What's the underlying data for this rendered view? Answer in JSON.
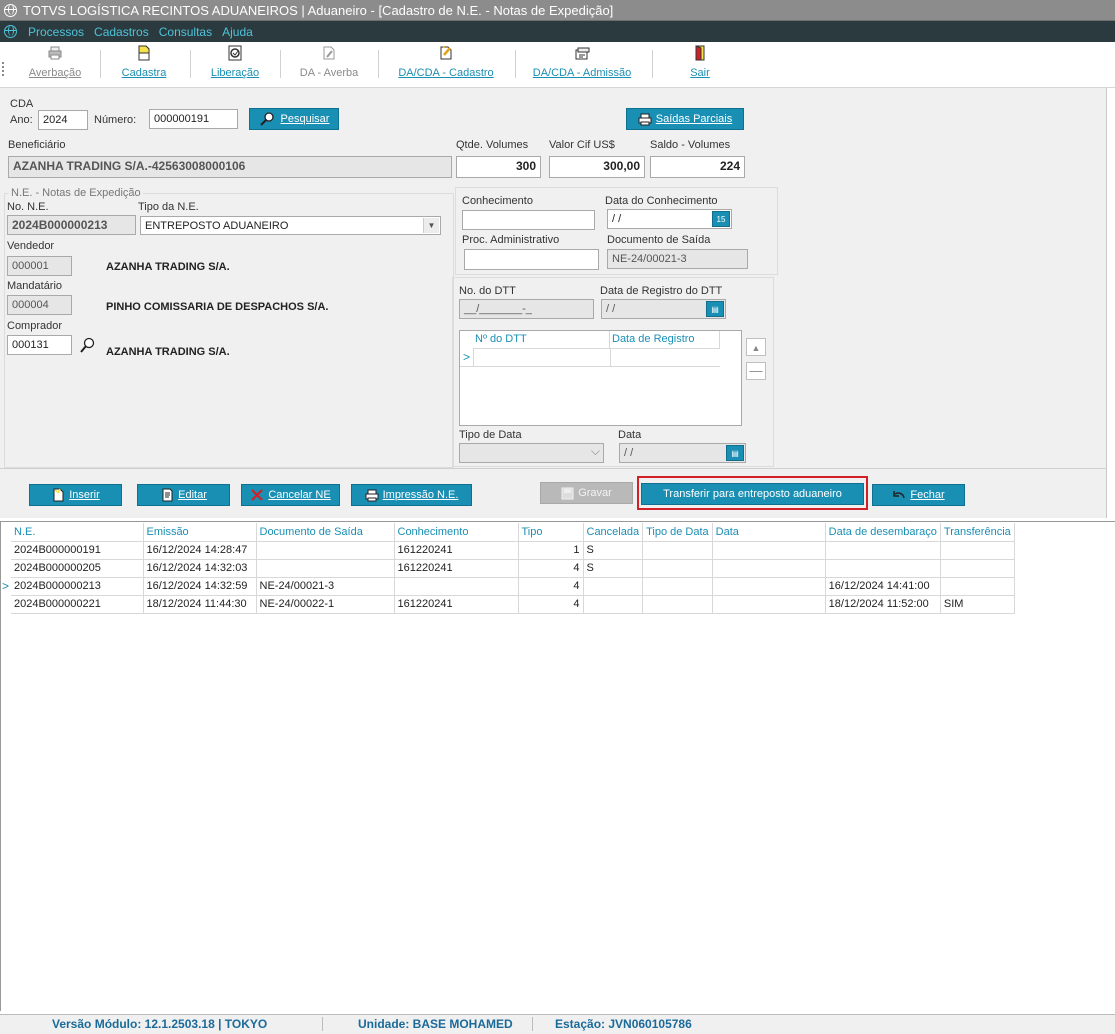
{
  "window": {
    "title": "TOTVS LOGÍSTICA RECINTOS ADUANEIROS | Aduaneiro - [Cadastro de N.E. - Notas de Expedição]"
  },
  "menu": [
    "Processos",
    "Cadastros",
    "Consultas",
    "Ajuda"
  ],
  "toolbar": {
    "averbacao": "Averbação",
    "cadastra": "Cadastra",
    "liberacao": "Liberação",
    "da_averba": "DA - Averba",
    "da_cda_cadastro": "DA/CDA - Cadastro",
    "da_cda_admissao": "DA/CDA - Admissão",
    "sair": "Sair"
  },
  "form": {
    "cda_label": "CDA",
    "ano_label": "Ano:",
    "ano_value": "2024",
    "numero_label": "Número:",
    "numero_value": "000000191",
    "pesquisar": "Pesquisar",
    "saidas_parciais": "Saídas Parciais",
    "beneficiario_label": "Beneficiário",
    "beneficiario_value": "AZANHA TRADING S/A.-42563008000106",
    "qtde_volumes_label": "Qtde. Volumes",
    "qtde_volumes_value": "300",
    "valor_cif_label": "Valor Cif US$",
    "valor_cif_value": "300,00",
    "saldo_volumes_label": "Saldo - Volumes",
    "saldo_volumes_value": "224",
    "ne_group_label": "N.E. - Notas de Expedição",
    "no_ne_label": "No. N.E.",
    "no_ne_value": "2024B000000213",
    "tipo_ne_label": "Tipo da N.E.",
    "tipo_ne_value": "ENTREPOSTO ADUANEIRO",
    "vendedor_label": "Vendedor",
    "vendedor_code": "000001",
    "vendedor_name": "AZANHA TRADING S/A.",
    "mandatario_label": "Mandatário",
    "mandatario_code": "000004",
    "mandatario_name": "PINHO COMISSARIA DE DESPACHOS S/A.",
    "comprador_label": "Comprador",
    "comprador_code": "000131",
    "comprador_name": "AZANHA TRADING S/A.",
    "conhecimento_label": "Conhecimento",
    "conhecimento_value": "",
    "data_conhecimento_label": "Data do Conhecimento",
    "data_conhecimento_value": " / /",
    "proc_adm_label": "Proc. Administrativo",
    "proc_adm_value": "",
    "doc_saida_label": "Documento de Saída",
    "doc_saida_value": "NE-24/00021-3",
    "no_dtt_label": "No. do DTT",
    "no_dtt_value": "__/_______-_",
    "data_reg_dtt_label": "Data de Registro do DTT",
    "data_reg_dtt_value": " / /",
    "dtt_grid_col1": "Nº do DTT",
    "dtt_grid_col2": "Data de Registro",
    "tipo_data_label": "Tipo de Data",
    "data_label": "Data",
    "data_value": " / /",
    "cal_icon_text": "15"
  },
  "actions": {
    "inserir": "Inserir",
    "editar": "Editar",
    "cancelar_ne": "Cancelar NE",
    "impressao_ne": "Impressão N.E.",
    "gravar": "Gravar",
    "transferir": "Transferir para entreposto aduaneiro",
    "fechar": "Fechar"
  },
  "table": {
    "headers": [
      "N.E.",
      "Emissão",
      "Documento de Saída",
      "Conhecimento",
      "Tipo",
      "Cancelada",
      "Tipo de Data",
      "Data",
      "Data de desembaraço",
      "Transferência"
    ],
    "rows": [
      [
        "2024B000000191",
        "16/12/2024 14:28:47",
        "",
        "161220241",
        "1",
        "S",
        "",
        "",
        "",
        ""
      ],
      [
        "2024B000000205",
        "16/12/2024 14:32:03",
        "",
        "161220241",
        "4",
        "S",
        "",
        "",
        "",
        ""
      ],
      [
        "2024B000000213",
        "16/12/2024 14:32:59",
        "NE-24/00021-3",
        "",
        "4",
        "",
        "",
        "",
        "16/12/2024 14:41:00",
        ""
      ],
      [
        "2024B000000221",
        "18/12/2024 11:44:30",
        "NE-24/00022-1",
        "161220241",
        "4",
        "",
        "",
        "",
        "18/12/2024 11:52:00",
        "SIM"
      ]
    ],
    "current_row": 2
  },
  "status": {
    "versao": "Versão Módulo:  12.1.2503.18  |  TOKYO",
    "unidade": "Unidade:  BASE MOHAMED",
    "estacao": "Estação:  JVN060105786"
  },
  "colors": {
    "accent": "#1a8fb4",
    "menu_bg": "#2b3a3f",
    "highlight": "#d32027"
  }
}
